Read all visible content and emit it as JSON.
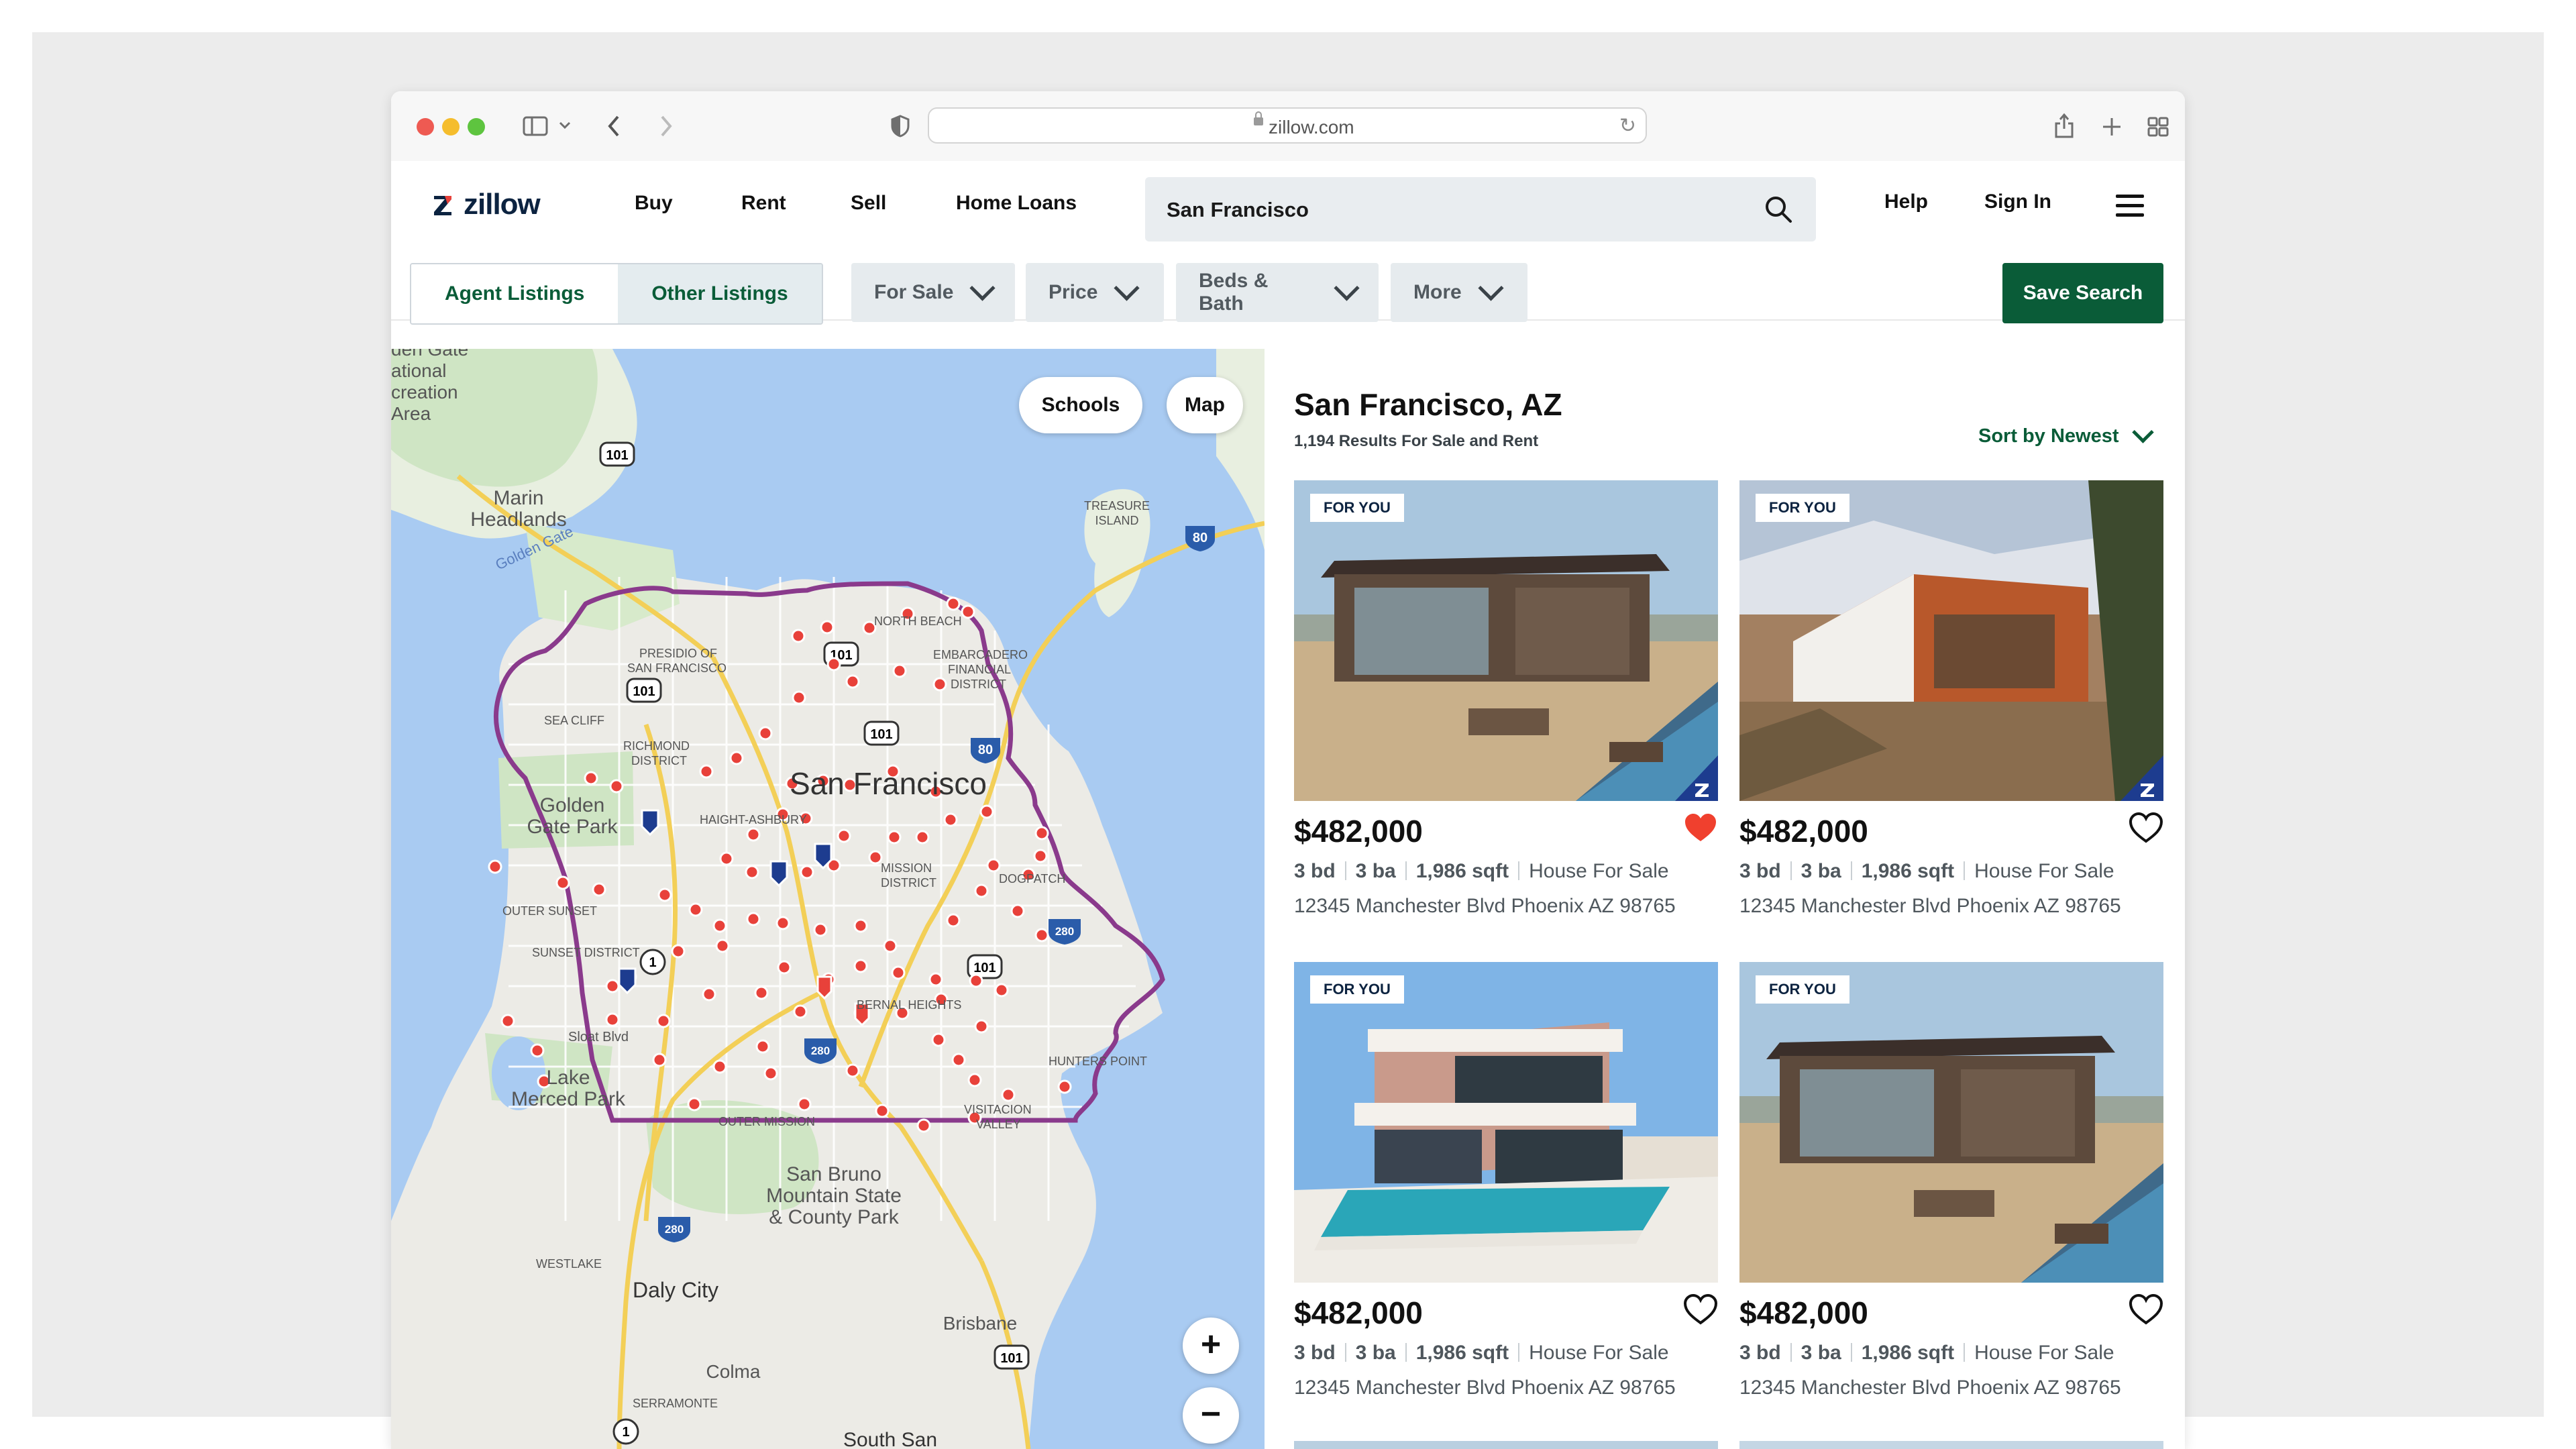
{
  "browser": {
    "url": "zillow.com"
  },
  "header": {
    "brand": "zillow",
    "nav": [
      "Buy",
      "Rent",
      "Sell",
      "Home Loans"
    ],
    "search_value": "San Francisco",
    "help": "Help",
    "sign_in": "Sign In"
  },
  "filters": {
    "agent_listings": "Agent Listings",
    "other_listings": "Other Listings",
    "for_sale": "For Sale",
    "price": "Price",
    "beds_bath": "Beds & Bath",
    "more": "More",
    "save_search": "Save Search"
  },
  "map": {
    "schools": "Schools",
    "map_toggle": "Map",
    "zoom_in": "+",
    "zoom_out": "−",
    "labels": {
      "golden_gate_top": "den Gate",
      "national": "ational",
      "creation": "creation",
      "area": "Area",
      "marin": "Marin",
      "headlands": "Headlands",
      "golden_gate": "Golden Gate",
      "treasure": "TREASURE",
      "island": "ISLAND",
      "north_beach": "NORTH BEACH",
      "presidio": "PRESIDIO OF",
      "san_francisco_small": "SAN FRANCISCO",
      "embarcadero": "EMBARCADERO",
      "financial": "FINANCIAL",
      "district": "DISTRICT",
      "sea_cliff": "SEA CLIFF",
      "richmond": "RICHMOND",
      "richmond_district": "DISTRICT",
      "city": "San Francisco",
      "golden": "Golden",
      "gate_park": "Gate Park",
      "haight": "HAIGHT-ASHBURY",
      "mission": "MISSION",
      "mission_district": "DISTRICT",
      "dogpatch": "DOGPATCH",
      "outer_sunset": "OUTER SUNSET",
      "sunset_district": "SUNSET DISTRICT",
      "bernal": "BERNAL HEIGHTS",
      "sloat": "Sloat Blvd",
      "hunters_point": "HUNTERS POINT",
      "lake": "Lake",
      "merced": "Merced Park",
      "visitacion": "VISITACION",
      "valley": "VALLEY",
      "outer_mission": "OUTER MISSION",
      "san_bruno": "San Bruno",
      "mountain_state": "Mountain State",
      "county_park": "& County Park",
      "westlake": "WESTLAKE",
      "daly_city": "Daly City",
      "brisbane": "Brisbane",
      "colma": "Colma",
      "serramonte": "SERRAMONTE",
      "south_san": "South San",
      "shield_101a": "101",
      "shield_101b": "101",
      "shield_101c": "101",
      "shield_101d": "101",
      "shield_101e": "101",
      "shield_101f": "101",
      "shield_80a": "80",
      "shield_80b": "80",
      "shield_280a": "280",
      "shield_280b": "280",
      "shield_280c": "280",
      "shield_1a": "1",
      "shield_1b": "1"
    }
  },
  "results": {
    "title": "San Francisco, AZ",
    "count": "1,194 Results For Sale and Rent",
    "sort": "Sort by Newest",
    "listings": [
      {
        "badge": "FOR YOU",
        "price": "$482,000",
        "beds": "3 bd",
        "baths": "3 ba",
        "sqft": "1,986 sqft",
        "type": "House For Sale",
        "address": "12345 Manchester Blvd Phoenix AZ 98765",
        "saved": true
      },
      {
        "badge": "FOR YOU",
        "price": "$482,000",
        "beds": "3 bd",
        "baths": "3 ba",
        "sqft": "1,986 sqft",
        "type": "House For Sale",
        "address": "12345 Manchester Blvd Phoenix AZ 98765",
        "saved": false
      },
      {
        "badge": "FOR YOU",
        "price": "$482,000",
        "beds": "3 bd",
        "baths": "3 ba",
        "sqft": "1,986 sqft",
        "type": "House For Sale",
        "address": "12345 Manchester Blvd Phoenix AZ 98765",
        "saved": false
      },
      {
        "badge": "FOR YOU",
        "price": "$482,000",
        "beds": "3 bd",
        "baths": "3 ba",
        "sqft": "1,986 sqft",
        "type": "House For Sale",
        "address": "12345 Manchester Blvd Phoenix AZ 98765",
        "saved": false
      }
    ]
  },
  "colors": {
    "brand_navy": "#0c2340",
    "accent_green": "#0a5c38",
    "saved_heart": "#f0402e",
    "map_water": "#a9cbf2",
    "boundary": "#8a3a8c"
  },
  "icons": [
    "sidebar-icon",
    "back-icon",
    "forward-icon",
    "shield-icon",
    "lock-icon",
    "reload-icon",
    "share-icon",
    "new-tab-icon",
    "tab-overview-icon",
    "search-icon",
    "menu-icon",
    "chevron-down-icon",
    "heart-icon"
  ]
}
